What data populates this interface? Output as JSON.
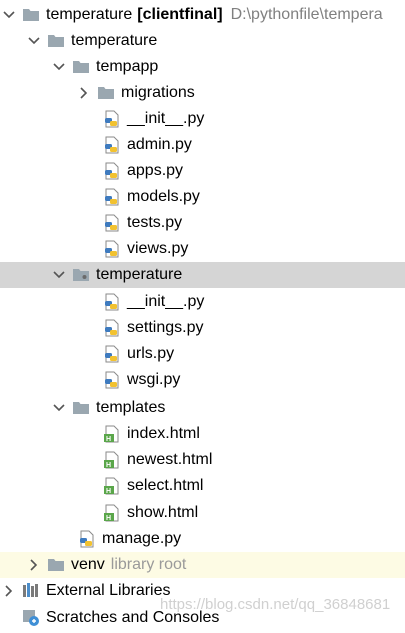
{
  "tree": {
    "root": {
      "label": "temperature",
      "module": "[clientfinal]",
      "path": "D:\\pythonfile\\tempera"
    },
    "project_dir": {
      "label": "temperature"
    },
    "tempapp": {
      "label": "tempapp"
    },
    "migrations": {
      "label": "migrations"
    },
    "tempapp_files": [
      "__init__.py",
      "admin.py",
      "apps.py",
      "models.py",
      "tests.py",
      "views.py"
    ],
    "pkg": {
      "label": "temperature"
    },
    "pkg_files": [
      "__init__.py",
      "settings.py",
      "urls.py",
      "wsgi.py"
    ],
    "templates": {
      "label": "templates"
    },
    "template_files": [
      "index.html",
      "newest.html",
      "select.html",
      "show.html"
    ],
    "manage": {
      "label": "manage.py"
    },
    "venv": {
      "label": "venv",
      "hint": "library root"
    },
    "external": {
      "label": "External Libraries"
    },
    "scratches": {
      "label": "Scratches and Consoles"
    }
  },
  "watermark": "https://blog.csdn.net/qq_36848681",
  "icons": {
    "folder": "folder-icon",
    "python": "python-file-icon",
    "html": "html-file-icon",
    "library": "library-icon",
    "scratch": "scratch-icon"
  },
  "colors": {
    "selection": "#d5d5d5",
    "venv_bg": "#fdfbe4",
    "path_text": "#808080",
    "hint_text": "#9a9a9a"
  }
}
